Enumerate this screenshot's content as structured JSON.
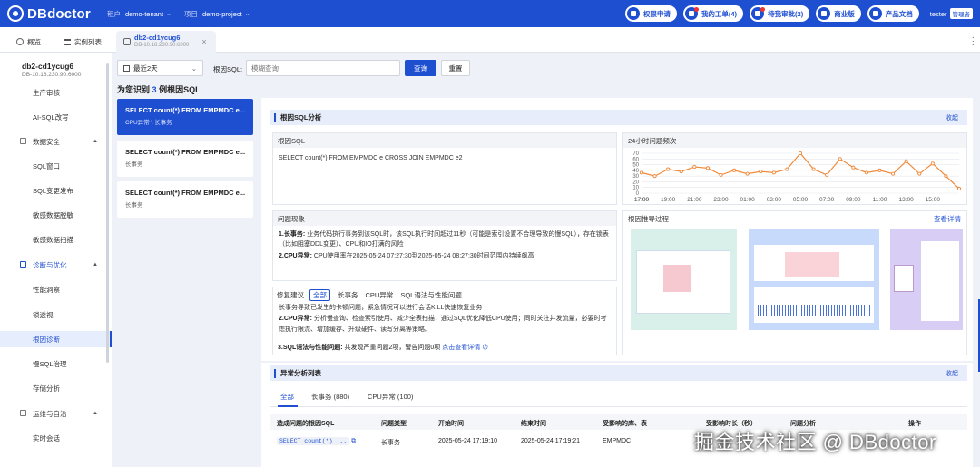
{
  "app": {
    "title": "DBdoctor",
    "tenant_label": "租户",
    "tenant": "demo-tenant",
    "project_label": "项目",
    "project": "demo-project"
  },
  "top_buttons": [
    {
      "label": "权限申请"
    },
    {
      "label": "我的工单(4)"
    },
    {
      "label": "待我审批(2)"
    },
    {
      "label": "商业版"
    },
    {
      "label": "产品文档"
    }
  ],
  "user": {
    "name": "tester",
    "role": "管理者"
  },
  "tabs": {
    "overview": "概览",
    "instances": "实例列表",
    "active_name": "db2-cd1ycug6",
    "active_addr": "DB-10.18.230.90:6000"
  },
  "sidebar": {
    "db_name": "db2-cd1ycug6",
    "db_addr": "DB-10.18.230.90:6000",
    "items": [
      "生产审核",
      "AI-SQL改写"
    ],
    "group_security": "数据安全",
    "security_items": [
      "SQL窗口",
      "SQL变更发布",
      "敏感数据脱敏",
      "敏感数据扫描"
    ],
    "group_diag": "诊断与优化",
    "diag_items": [
      "性能洞察",
      "锁透视",
      "根因诊断",
      "慢SQL治理",
      "存储分析"
    ],
    "group_ops": "运维与自治",
    "ops_items": [
      "实时会话"
    ]
  },
  "filter": {
    "range": "最近2天",
    "sql_label": "根因SQL:",
    "sql_placeholder": "模糊查询",
    "query": "查询",
    "reset": "重置"
  },
  "summary": {
    "prefix": "为您识别",
    "count": "3",
    "suffix": "例根因SQL"
  },
  "cards": [
    {
      "sql": "SELECT count(*) FROM EMPMDC e...",
      "tag": "CPU异常 \\ 长事务"
    },
    {
      "sql": "SELECT count(*) FROM EMPMDC e...",
      "tag": "长事务"
    },
    {
      "sql": "SELECT count(*) FROM EMPMDC e...",
      "tag": "长事务"
    }
  ],
  "analysis": {
    "title": "根因SQL分析",
    "collapse": "收起",
    "root_sql_title": "根因SQL",
    "root_sql": "SELECT count(*) FROM EMPMDC e CROSS JOIN EMPMDC e2",
    "freq_title": "24小时问题频次",
    "phenomena_title": "问题现象",
    "p1_head": "1.长事务:",
    "p1": " 业务代码执行事务到该SQL时，该SQL执行时间超过11秒（可能是索引设置不合理导致的慢SQL），存在锁表（比如阻塞DDL变更）、CPU和IO打满的风险",
    "p2_head": "2.CPU异常:",
    "p2": " CPU使用率在2025-05-24 07:27:30到2025-05-24 08:27:30时间范围内持续飙高",
    "reco_title": "根因推导过程",
    "reco_link": "查看详情",
    "advice_title": "修复建议",
    "advice_chips": [
      "全部",
      "长事务",
      "CPU异常",
      "SQL语法与性能问题"
    ],
    "a1": "长事务导致已发生的卡顿问题，紧急情况可以进行会话KILL快速恢复业务",
    "a2_head": "2.CPU异常:",
    "a2": " 分析慢查询、检查索引使用、减少全表扫描，通过SQL优化降低CPU使用；同时关注并发流量，必要时考虑执行限流、增加缓存、升级硬件、读写分离等策略。",
    "a3_head": "3.SQL语法与性能问题:",
    "a3": " 共发现严重问题2项，警告问题0项",
    "a3_link": "点击查看详情"
  },
  "chart_data": {
    "type": "line",
    "title": "24小时问题频次",
    "x": [
      "17:00",
      "18:00",
      "19:00",
      "20:00",
      "21:00",
      "22:00",
      "23:00",
      "00:00",
      "01:00",
      "02:00",
      "03:00",
      "04:00",
      "05:00",
      "06:00",
      "07:00",
      "08:00",
      "09:00",
      "10:00",
      "11:00",
      "12:00",
      "13:00",
      "14:00",
      "15:00",
      "16:00",
      "17:00"
    ],
    "x_ticks": [
      "17:00",
      "19:00",
      "21:00",
      "23:00",
      "01:00",
      "03:00",
      "05:00",
      "07:00",
      "09:00",
      "11:00",
      "13:00",
      "15:00",
      "17:00"
    ],
    "values": [
      36,
      30,
      42,
      38,
      46,
      44,
      32,
      40,
      34,
      38,
      36,
      42,
      70,
      42,
      32,
      60,
      45,
      36,
      40,
      34,
      56,
      34,
      52,
      30,
      8
    ],
    "y_ticks": [
      0,
      10,
      20,
      30,
      40,
      50,
      60,
      70
    ],
    "ylim": [
      0,
      70
    ],
    "grid": true,
    "color": "#f08a3c"
  },
  "anomaly": {
    "title": "异常分析列表",
    "collapse": "收起",
    "tabs": [
      "全部",
      "长事务 (880)",
      "CPU异常 (100)"
    ],
    "headers": [
      "造成问题的根因SQL",
      "问题类型",
      "开始时间",
      "结束时间",
      "受影响的库、表",
      "受影响时长（秒）",
      "问题分析",
      "操作"
    ],
    "row": {
      "sql": "SELECT count(*) ...",
      "type": "长事务",
      "start": "2025-05-24 17:19:10",
      "end": "2025-05-24 17:19:21",
      "tables": "EMPMDC"
    }
  },
  "watermark": "掘金技术社区 @ DBdoctor"
}
